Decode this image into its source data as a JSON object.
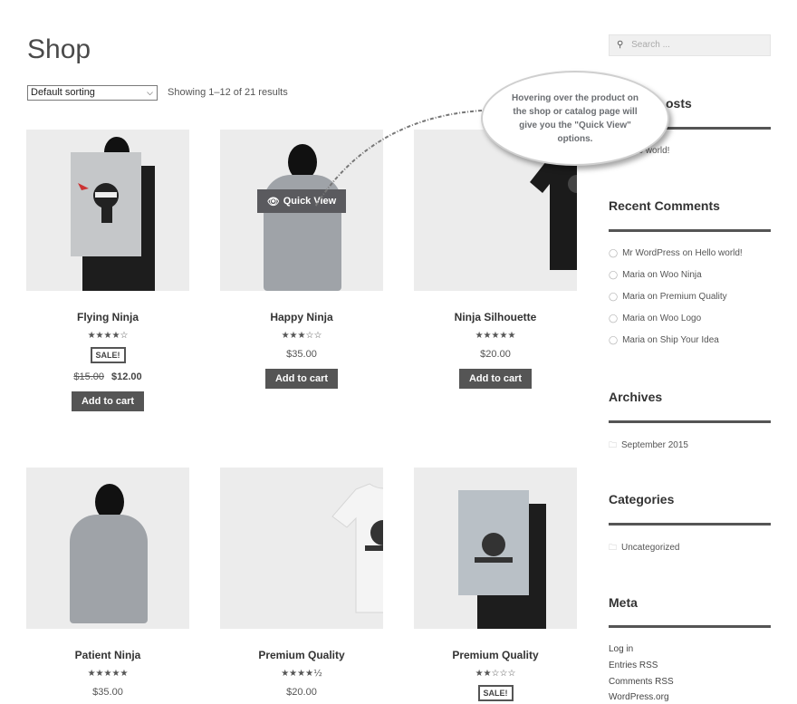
{
  "page": {
    "title": "Shop",
    "sorting_value": "Default sorting",
    "result_count": "Showing 1–12 of 21 results"
  },
  "quick_view_label": "Quick View",
  "callout": "Hovering over the product on the shop or catalog page will give you the \"Quick View\" options.",
  "products": [
    {
      "title": "Flying Ninja",
      "rating": 4,
      "sale": "SALE!",
      "old_price": "$15.00",
      "price": "$12.00",
      "button": "Add to cart"
    },
    {
      "title": "Happy Ninja",
      "rating": 3,
      "price": "$35.00",
      "button": "Add to cart"
    },
    {
      "title": "Ninja Silhouette",
      "rating": 5,
      "price": "$20.00",
      "button": "Add to cart"
    },
    {
      "title": "Patient Ninja",
      "rating": 5,
      "price": "$35.00"
    },
    {
      "title": "Premium Quality",
      "rating": 4.5,
      "price": "$20.00"
    },
    {
      "title": "Premium Quality",
      "rating": 2,
      "sale": "SALE!"
    }
  ],
  "sidebar": {
    "search_placeholder": "Search ...",
    "recent_posts_title": "Recent Posts",
    "recent_posts_title_visible": "osts",
    "recent_post_visible": "llo world!",
    "recent_comments_title": "Recent Comments",
    "comments": [
      "Mr WordPress on Hello world!",
      "Maria on Woo Ninja",
      "Maria on Premium Quality",
      "Maria on Woo Logo",
      "Maria on Ship Your Idea"
    ],
    "archives_title": "Archives",
    "archives": [
      "September 2015"
    ],
    "categories_title": "Categories",
    "categories": [
      "Uncategorized"
    ],
    "meta_title": "Meta",
    "meta": [
      "Log in",
      "Entries RSS",
      "Comments RSS",
      "WordPress.org"
    ]
  },
  "icons": {
    "search": "search-icon",
    "eye": "eye-icon",
    "comment": "comment-icon",
    "folder": "folder-icon"
  },
  "colors": {
    "button_bg": "#555555",
    "text": "#43454b",
    "rule": "#555555",
    "image_bg": "#ececec"
  }
}
